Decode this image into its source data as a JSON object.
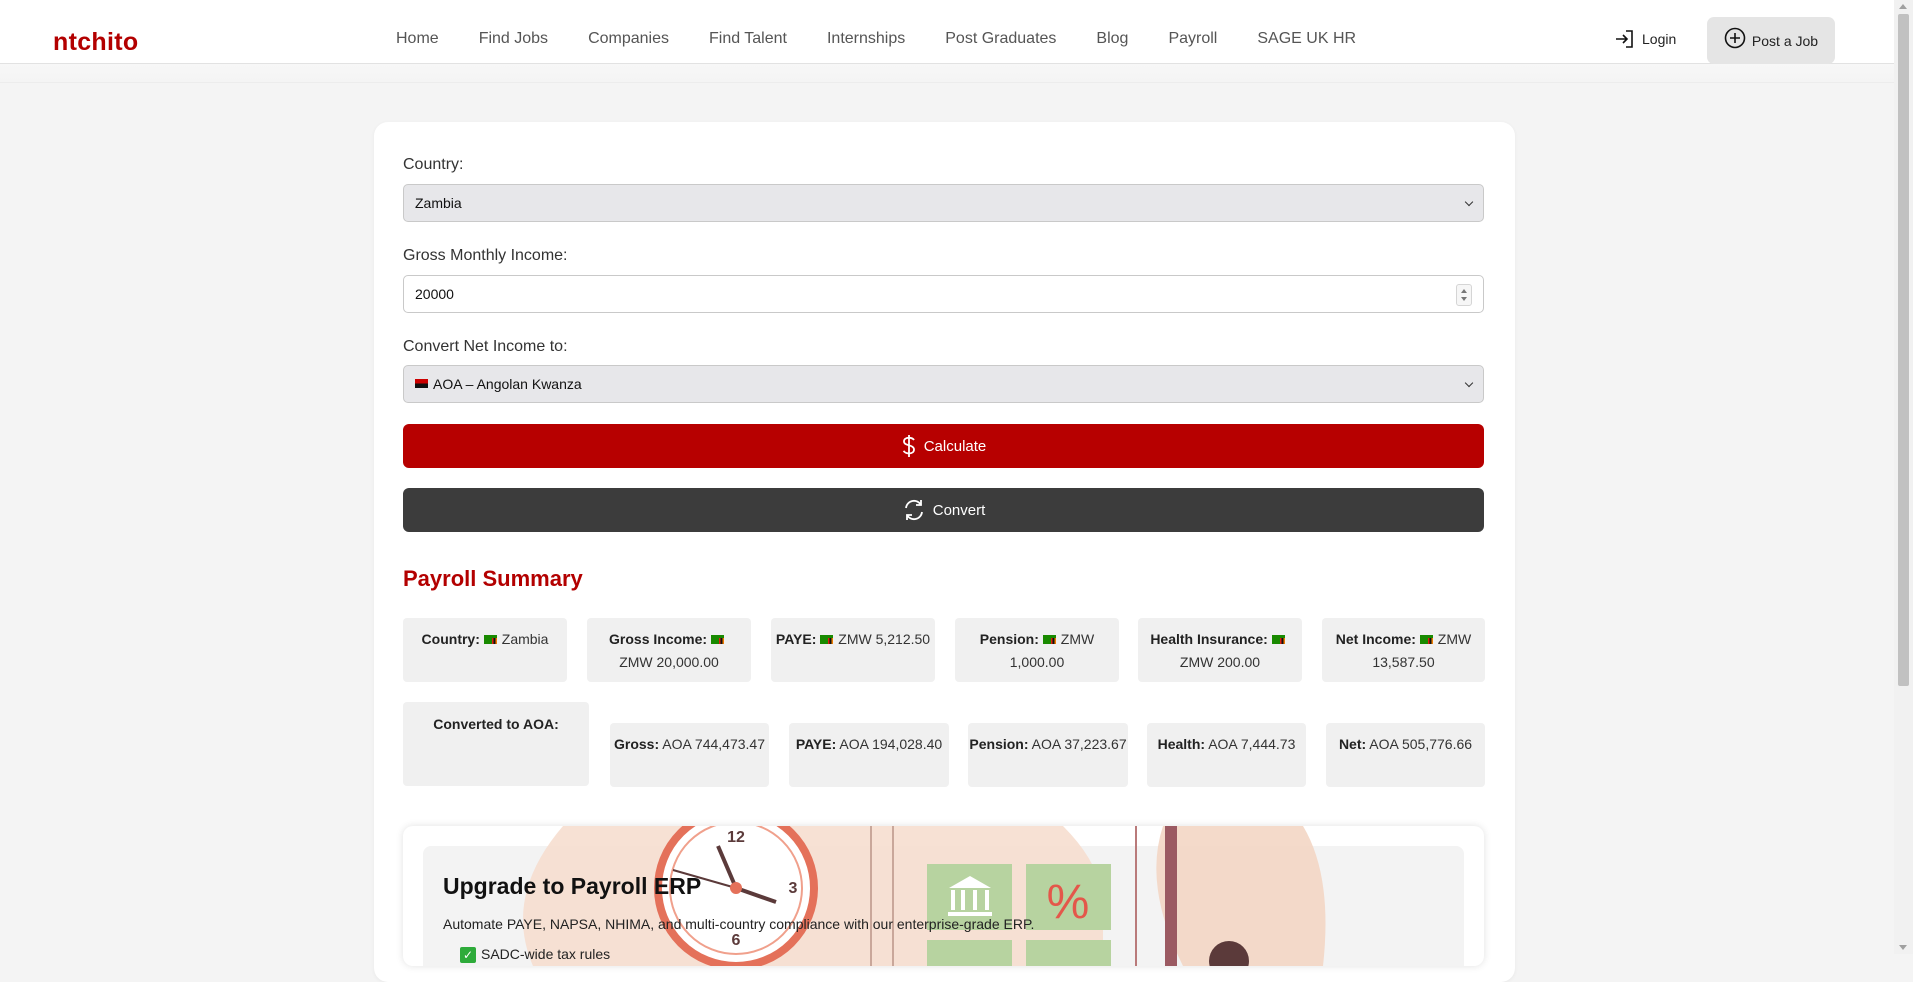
{
  "header": {
    "logo": "ntchito",
    "nav": [
      "Home",
      "Find Jobs",
      "Companies",
      "Find Talent",
      "Internships",
      "Post Graduates",
      "Blog",
      "Payroll",
      "SAGE UK HR"
    ],
    "login_label": "Login",
    "post_job_label": "Post a Job"
  },
  "form": {
    "country_label": "Country:",
    "country_value": "Zambia",
    "income_label": "Gross Monthly Income:",
    "income_value": "20000",
    "convert_label": "Convert Net Income to:",
    "convert_value": "AOA – Angolan Kwanza",
    "calculate_label": "Calculate",
    "convert_button_label": "Convert"
  },
  "summary": {
    "title": "Payroll Summary",
    "items": [
      {
        "label": "Country:",
        "value": "Zambia"
      },
      {
        "label": "Gross Income:",
        "value": "ZMW 20,000.00"
      },
      {
        "label": "PAYE:",
        "value": "ZMW 5,212.50"
      },
      {
        "label": "Pension:",
        "value": "ZMW 1,000.00"
      },
      {
        "label": "Health Insurance:",
        "value": "ZMW 200.00"
      },
      {
        "label": "Net Income:",
        "value": "ZMW 13,587.50"
      }
    ],
    "converted_label": "Converted to AOA:",
    "converted": [
      {
        "label": "Gross:",
        "value": "AOA 744,473.47"
      },
      {
        "label": "PAYE:",
        "value": "AOA 194,028.40"
      },
      {
        "label": "Pension:",
        "value": "AOA 37,223.67"
      },
      {
        "label": "Health:",
        "value": "AOA 7,444.73"
      },
      {
        "label": "Net:",
        "value": "AOA 505,776.66"
      }
    ]
  },
  "banner": {
    "title": "Upgrade to Payroll ERP",
    "subtitle": "Automate PAYE, NAPSA, NHIMA, and multi-country compliance with our enterprise-grade ERP.",
    "first_item": "SADC-wide tax rules",
    "clock_numbers": [
      "12",
      "3",
      "6"
    ],
    "percent_symbol": "%"
  },
  "colors": {
    "brand": "#b30000",
    "calculate_button": "#b70000",
    "convert_button": "#3c3c3c"
  }
}
